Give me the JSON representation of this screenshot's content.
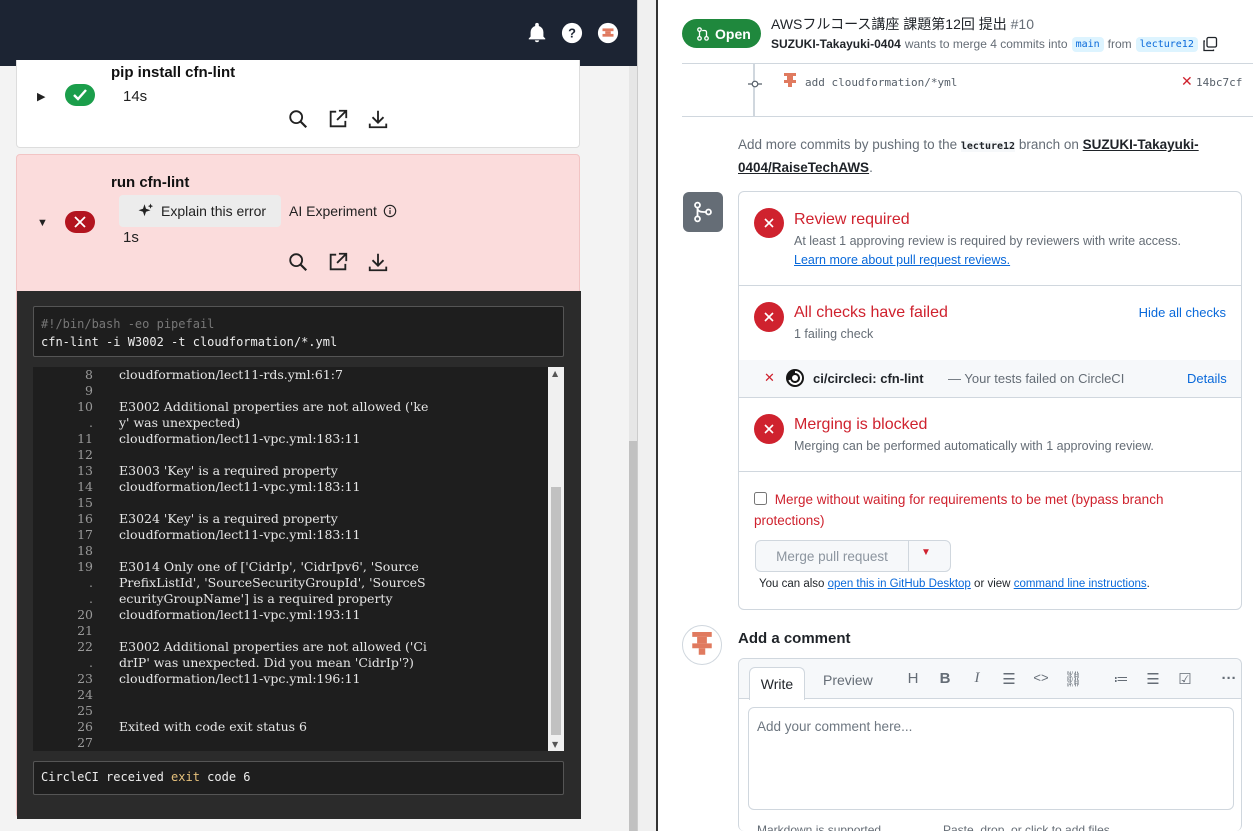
{
  "left": {
    "step1": {
      "name": "pip install cfn-lint",
      "duration": "14s"
    },
    "step2": {
      "name": "run cfn-lint",
      "duration": "1s",
      "explain_label": "Explain this error",
      "ai_label": "AI Experiment"
    },
    "command": {
      "shebang": "#!/bin/bash -eo pipefail",
      "line": "cfn-lint -i W3002 -t cloudformation/*.yml"
    },
    "log": [
      {
        "n": "8",
        "t": "cloudformation/lect11-rds.yml:61:7"
      },
      {
        "n": "9",
        "t": ""
      },
      {
        "n": "10",
        "t": "E3002 Additional properties are not allowed ('ke"
      },
      {
        "n": ".",
        "t": "y' was unexpected)"
      },
      {
        "n": "11",
        "t": "cloudformation/lect11-vpc.yml:183:11"
      },
      {
        "n": "12",
        "t": ""
      },
      {
        "n": "13",
        "t": "E3003 'Key' is a required property"
      },
      {
        "n": "14",
        "t": "cloudformation/lect11-vpc.yml:183:11"
      },
      {
        "n": "15",
        "t": ""
      },
      {
        "n": "16",
        "t": "E3024 'Key' is a required property"
      },
      {
        "n": "17",
        "t": "cloudformation/lect11-vpc.yml:183:11"
      },
      {
        "n": "18",
        "t": ""
      },
      {
        "n": "19",
        "t": "E3014 Only one of ['CidrIp', 'CidrIpv6', 'Source"
      },
      {
        "n": ".",
        "t": "PrefixListId', 'SourceSecurityGroupId', 'SourceS"
      },
      {
        "n": ".",
        "t": "ecurityGroupName'] is a required property"
      },
      {
        "n": "20",
        "t": "cloudformation/lect11-vpc.yml:193:11"
      },
      {
        "n": "21",
        "t": ""
      },
      {
        "n": "22",
        "t": "E3002 Additional properties are not allowed ('Ci"
      },
      {
        "n": ".",
        "t": "drIP' was unexpected. Did you mean 'CidrIp'?)"
      },
      {
        "n": "23",
        "t": "cloudformation/lect11-vpc.yml:196:11"
      },
      {
        "n": "24",
        "t": ""
      },
      {
        "n": "25",
        "t": ""
      },
      {
        "n": "26",
        "t": "Exited with code exit status 6"
      },
      {
        "n": "27",
        "t": ""
      }
    ],
    "received": {
      "pre": "CircleCI received ",
      "kw": "exit",
      "post": " code 6"
    }
  },
  "pr": {
    "state": "Open",
    "title": "AWSフルコース講座 課題第12回 提出",
    "number": "#10",
    "author": "SUZUKI-Takayuki-0404",
    "wants": "wants to merge 4 commits into",
    "base": "main",
    "from": "from",
    "head": "lecture12",
    "commit_msg": "add cloudformation/*yml",
    "commit_sha": "14bc7cf",
    "add_more_1": "Add more commits by pushing to the",
    "add_more_branch": "lecture12",
    "add_more_2": "branch on",
    "add_more_repo": "SUZUKI-Takayuki-0404/RaiseTechAWS",
    "review_title": "Review required",
    "review_desc": "At least 1 approving review is required by reviewers with write access.",
    "review_link": "Learn more about pull request reviews.",
    "checks_title": "All checks have failed",
    "checks_desc": "1 failing check",
    "hide_checks": "Hide all checks",
    "check_name": "ci/circleci: cfn-lint",
    "check_desc": "— Your tests failed on CircleCI",
    "check_details": "Details",
    "blocked_title": "Merging is blocked",
    "blocked_desc": "Merging can be performed automatically with 1 approving review.",
    "bypass": "Merge without waiting for requirements to be met (bypass branch protections)",
    "merge_btn": "Merge pull request",
    "also_1": "You can also",
    "also_link1": "open this in GitHub Desktop",
    "also_2": "or view",
    "also_link2": "command line instructions",
    "also_3": ".",
    "add_comment": "Add a comment",
    "tab_write": "Write",
    "tab_preview": "Preview",
    "placeholder": "Add your comment here...",
    "foot_md": "Markdown is supported",
    "foot_paste": "Paste, drop, or click to add files"
  },
  "colors": {
    "accent_green": "#1f883d",
    "danger": "#cf222e",
    "link": "#0969da"
  }
}
